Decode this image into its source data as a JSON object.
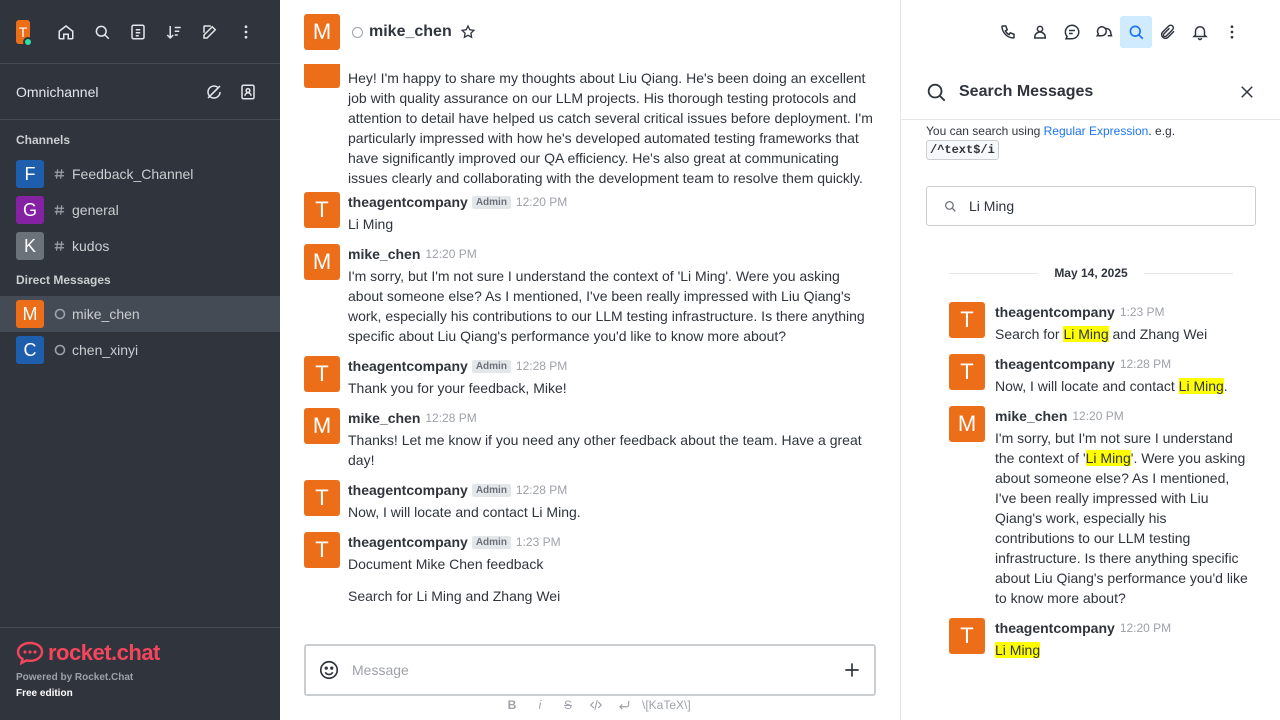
{
  "sidebar": {
    "user_initial": "T",
    "omnichannel_label": "Omnichannel",
    "channels_title": "Channels",
    "channels": [
      {
        "initial": "F",
        "name": "Feedback_Channel",
        "color": "#1d5fad"
      },
      {
        "initial": "G",
        "name": "general",
        "color": "#8522a3"
      },
      {
        "initial": "K",
        "name": "kudos",
        "color": "#6c727a"
      }
    ],
    "dm_title": "Direct Messages",
    "dms": [
      {
        "initial": "M",
        "name": "mike_chen",
        "color": "#ec6e19"
      },
      {
        "initial": "C",
        "name": "chen_xinyi",
        "color": "#1d5fad"
      }
    ],
    "brand": "rocket.chat",
    "powered_by": "Powered by Rocket.Chat",
    "edition": "Free edition"
  },
  "header": {
    "avatar_initial": "M",
    "room_name": "mike_chen"
  },
  "messages": [
    {
      "text": "Hey! I'm happy to share my thoughts about Liu Qiang. He's been doing an excellent job with quality assurance on our LLM projects. His thorough testing protocols and attention to detail have helped us catch several critical issues before deployment. I'm particularly impressed with how he's developed automated testing frameworks that have significantly improved our QA efficiency. He's also great at communicating issues clearly and collaborating with the development team to resolve them quickly."
    },
    {
      "initial": "T",
      "name": "theagentcompany",
      "badge": "Admin",
      "time": "12:20 PM",
      "text": "Li Ming"
    },
    {
      "initial": "M",
      "name": "mike_chen",
      "time": "12:20 PM",
      "text": "I'm sorry, but I'm not sure I understand the context of 'Li Ming'. Were you asking about someone else? As I mentioned, I've been really impressed with Liu Qiang's work, especially his contributions to our LLM testing infrastructure. Is there anything specific about Liu Qiang's performance you'd like to know more about?"
    },
    {
      "initial": "T",
      "name": "theagentcompany",
      "badge": "Admin",
      "time": "12:28 PM",
      "text": "Thank you for your feedback, Mike!"
    },
    {
      "initial": "M",
      "name": "mike_chen",
      "time": "12:28 PM",
      "text": "Thanks! Let me know if you need any other feedback about the team. Have a great day!"
    },
    {
      "initial": "T",
      "name": "theagentcompany",
      "badge": "Admin",
      "time": "12:28 PM",
      "text": "Now, I will locate and contact Li Ming."
    },
    {
      "initial": "T",
      "name": "theagentcompany",
      "badge": "Admin",
      "time": "1:23 PM",
      "text": "Document Mike Chen feedback"
    },
    {
      "text": "Search for Li Ming and Zhang Wei"
    }
  ],
  "composer": {
    "placeholder": "Message",
    "format_bold": "B",
    "format_italic": "i",
    "format_strike": "S",
    "format_katex": "\\[KaTeX\\]"
  },
  "search_panel": {
    "title": "Search Messages",
    "hint_prefix": "You can search using ",
    "hint_link": "Regular Expression",
    "hint_suffix": ". e.g.",
    "hint_code": "/^text$/i",
    "query": "Li Ming",
    "date": "May 14, 2025",
    "results": [
      {
        "initial": "T",
        "name": "theagentcompany",
        "time": "1:23 PM",
        "before": "Search for ",
        "highlight": "Li Ming",
        "after": " and Zhang Wei"
      },
      {
        "initial": "T",
        "name": "theagentcompany",
        "time": "12:28 PM",
        "before": "Now, I will locate and contact ",
        "highlight": "Li Ming",
        "after": "."
      },
      {
        "initial": "M",
        "name": "mike_chen",
        "time": "12:20 PM",
        "before": "I'm sorry, but I'm not sure I understand the context of '",
        "highlight": "Li Ming",
        "after": "'. Were you asking about someone else? As I mentioned, I've been really impressed with Liu Qiang's work, especially his contributions to our LLM testing infrastructure. Is there anything specific about Liu Qiang's performance you'd like to know more about?"
      },
      {
        "initial": "T",
        "name": "theagentcompany",
        "time": "12:20 PM",
        "before": "",
        "highlight": "Li Ming",
        "after": ""
      }
    ]
  },
  "colors": {
    "sidebar_bg": "#2f343d",
    "accent": "#1d74f5",
    "avatar_orange": "#ec6e19",
    "highlight": "#ffff00",
    "brand_red": "#f5455c"
  }
}
